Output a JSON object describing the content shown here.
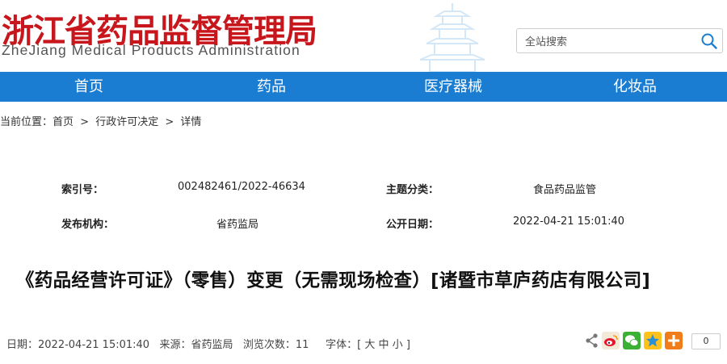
{
  "header": {
    "title": "浙江省药品监督管理局",
    "subtitle": "ZheJiang Medical Products Administration",
    "search_placeholder": "全站搜索"
  },
  "nav": {
    "items": [
      {
        "label": "首页"
      },
      {
        "label": "药品"
      },
      {
        "label": "医疗器械"
      },
      {
        "label": "化妆品"
      }
    ]
  },
  "breadcrumb": {
    "prefix": "当前位置：",
    "home": "首页",
    "sep1": ">",
    "section": "行政许可决定",
    "sep2": ">",
    "current": "详情"
  },
  "meta": {
    "index_label": "索引号：",
    "index_value": "002482461/2022-46634",
    "topic_label": "主题分类：",
    "topic_value": "食品药品监管",
    "publisher_label": "发布机构：",
    "publisher_value": "省药监局",
    "date_label": "公开日期：",
    "date_value": "2022-04-21 15:01:40"
  },
  "article": {
    "title": "《药品经营许可证》（零售）变更（无需现场检查）[诸暨市草庐药店有限公司]"
  },
  "info_bar": {
    "date": "日期：2022-04-21 15:01:40",
    "source": "来源：省药监局",
    "views": "浏览次数：11",
    "font_label": "字体：[",
    "font_large": "大",
    "font_medium": "中",
    "font_small": "小",
    "font_close": "]"
  },
  "share": {
    "icons": [
      "share-icon",
      "weibo-icon",
      "wechat-icon",
      "qzone-icon",
      "more-share-icon"
    ],
    "count": "0"
  },
  "colors": {
    "brand_red": "#c8161d",
    "nav_blue": "#1a7dd1"
  }
}
